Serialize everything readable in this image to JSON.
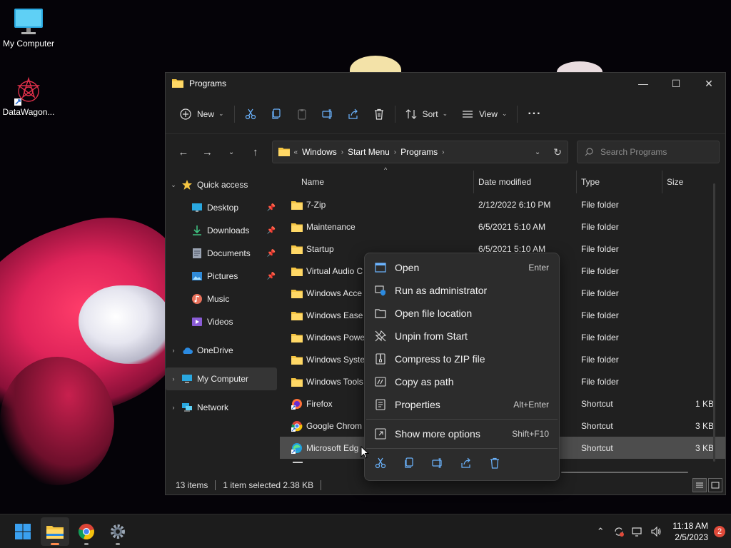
{
  "desktop": {
    "icons": [
      {
        "label": "My Computer",
        "icon": "monitor-icon"
      },
      {
        "label": "DataWagon...",
        "icon": "datawagon-logo-icon"
      }
    ]
  },
  "window": {
    "title": "Programs",
    "caption": {
      "minimize": "—",
      "maximize": "☐",
      "close": "✕"
    }
  },
  "commandbar": {
    "new_label": "New",
    "sort_label": "Sort",
    "view_label": "View",
    "more_label": "···"
  },
  "address": {
    "overflow": "«",
    "crumbs": [
      "Windows",
      "Start Menu",
      "Programs"
    ]
  },
  "search": {
    "placeholder": "Search Programs"
  },
  "sidebar": {
    "quick_access": "Quick access",
    "items": [
      {
        "label": "Desktop",
        "icon": "desktop-icon"
      },
      {
        "label": "Downloads",
        "icon": "download-icon"
      },
      {
        "label": "Documents",
        "icon": "documents-icon"
      },
      {
        "label": "Pictures",
        "icon": "pictures-icon"
      },
      {
        "label": "Music",
        "icon": "music-icon"
      },
      {
        "label": "Videos",
        "icon": "videos-icon"
      }
    ],
    "onedrive": "OneDrive",
    "my_computer": "My Computer",
    "network": "Network"
  },
  "columns": {
    "name": "Name",
    "date": "Date modified",
    "type": "Type",
    "size": "Size"
  },
  "files": [
    {
      "name": "7-Zip",
      "date": "2/12/2022 6:10 PM",
      "type": "File folder",
      "size": "",
      "kind": "folder"
    },
    {
      "name": "Maintenance",
      "date": "6/5/2021 5:10 AM",
      "type": "File folder",
      "size": "",
      "kind": "folder"
    },
    {
      "name": "Startup",
      "date": "6/5/2021 5:10 AM",
      "type": "File folder",
      "size": "",
      "kind": "folder"
    },
    {
      "name": "Virtual Audio C",
      "date": "",
      "type": "File folder",
      "size": "",
      "kind": "folder"
    },
    {
      "name": "Windows Acce",
      "date": "",
      "type": "File folder",
      "size": "",
      "kind": "folder"
    },
    {
      "name": "Windows Ease",
      "date": "",
      "type": "File folder",
      "size": "",
      "kind": "folder"
    },
    {
      "name": "Windows Powe",
      "date": "",
      "type": "File folder",
      "size": "",
      "kind": "folder"
    },
    {
      "name": "Windows Syste",
      "date": "",
      "type": "File folder",
      "size": "",
      "kind": "folder"
    },
    {
      "name": "Windows Tools",
      "date": "",
      "type": "File folder",
      "size": "",
      "kind": "folder"
    },
    {
      "name": "Firefox",
      "date": "",
      "type": "Shortcut",
      "size": "1 KB",
      "kind": "firefox"
    },
    {
      "name": "Google Chrom",
      "date": "",
      "type": "Shortcut",
      "size": "3 KB",
      "kind": "chrome"
    },
    {
      "name": "Microsoft Edg",
      "date": "",
      "type": "Shortcut",
      "size": "3 KB",
      "kind": "edge",
      "selected": true
    }
  ],
  "status": {
    "count": "13 items",
    "selection": "1 item selected  2.38 KB"
  },
  "context_menu": {
    "items": [
      {
        "label": "Open",
        "shortcut": "Enter",
        "icon": "open-icon"
      },
      {
        "label": "Run as administrator",
        "shortcut": "",
        "icon": "shield-icon"
      },
      {
        "label": "Open file location",
        "shortcut": "",
        "icon": "folder-icon"
      },
      {
        "label": "Unpin from Start",
        "shortcut": "",
        "icon": "unpin-icon"
      },
      {
        "label": "Compress to ZIP file",
        "shortcut": "",
        "icon": "zip-icon"
      },
      {
        "label": "Copy as path",
        "shortcut": "",
        "icon": "copy-path-icon"
      },
      {
        "label": "Properties",
        "shortcut": "Alt+Enter",
        "icon": "properties-icon"
      }
    ],
    "more": {
      "label": "Show more options",
      "shortcut": "Shift+F10"
    }
  },
  "taskbar": {
    "time": "11:18 AM",
    "date": "2/5/2023",
    "notifications": "2"
  },
  "colors": {
    "accent": "#0078d4",
    "folder": "#f5c542"
  }
}
